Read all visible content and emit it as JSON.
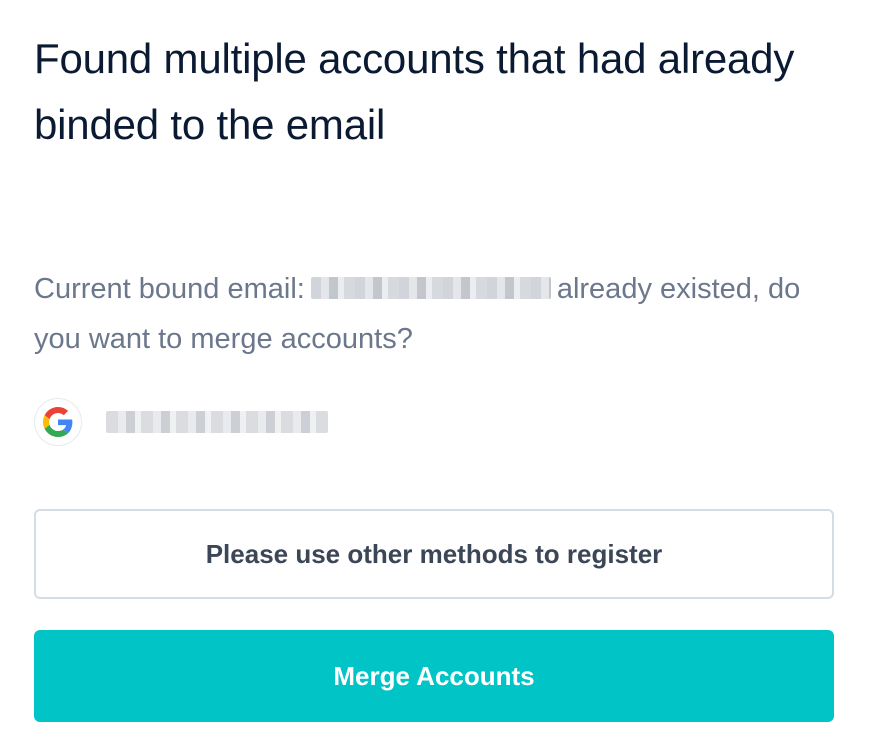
{
  "dialog": {
    "title": "Found multiple accounts that had already binded to the email",
    "message_prefix": "Current bound email:",
    "message_suffix": "already existed, do you want to merge accounts?"
  },
  "account": {
    "provider_icon": "google-icon"
  },
  "buttons": {
    "other_methods_label": "Please use other methods to register",
    "merge_label": "Merge Accounts"
  },
  "colors": {
    "primary": "#00c4c5",
    "title_text": "#0b1a33",
    "body_text": "#6b778c",
    "secondary_border": "#d6dce4"
  }
}
